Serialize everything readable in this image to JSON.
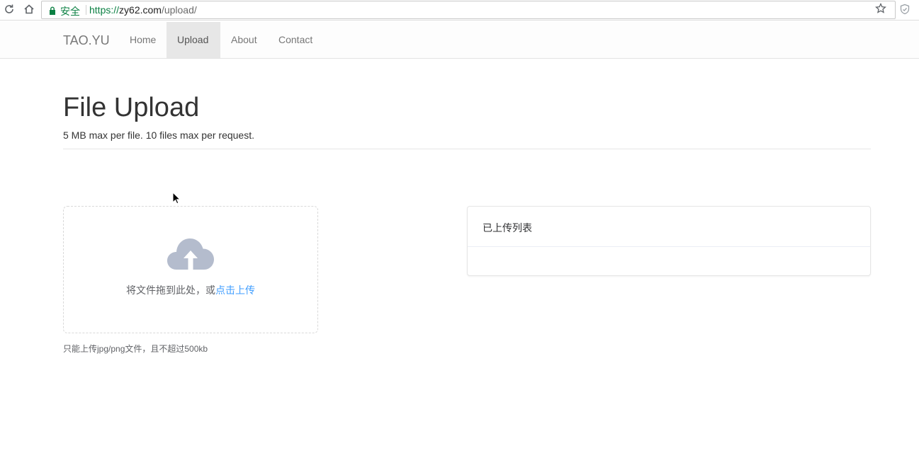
{
  "browser": {
    "security_label": "安全",
    "url_scheme": "https://",
    "url_host": "zy62.com",
    "url_path": "/upload/"
  },
  "navbar": {
    "brand": "TAO.YU",
    "links": [
      {
        "label": "Home",
        "active": false
      },
      {
        "label": "Upload",
        "active": true
      },
      {
        "label": "About",
        "active": false
      },
      {
        "label": "Contact",
        "active": false
      }
    ]
  },
  "header": {
    "title": "File Upload",
    "subtitle": "5 MB max per file. 10 files max per request."
  },
  "upload": {
    "drop_text": "将文件拖到此处，或",
    "click_text": "点击上传",
    "tip": "只能上传jpg/png文件，且不超过500kb",
    "icon": "upload-cloud-icon"
  },
  "uploaded_list": {
    "title": "已上传列表"
  },
  "colors": {
    "accent": "#409eff",
    "secure_green": "#0b8043",
    "cloud_icon": "#b4bccd"
  }
}
